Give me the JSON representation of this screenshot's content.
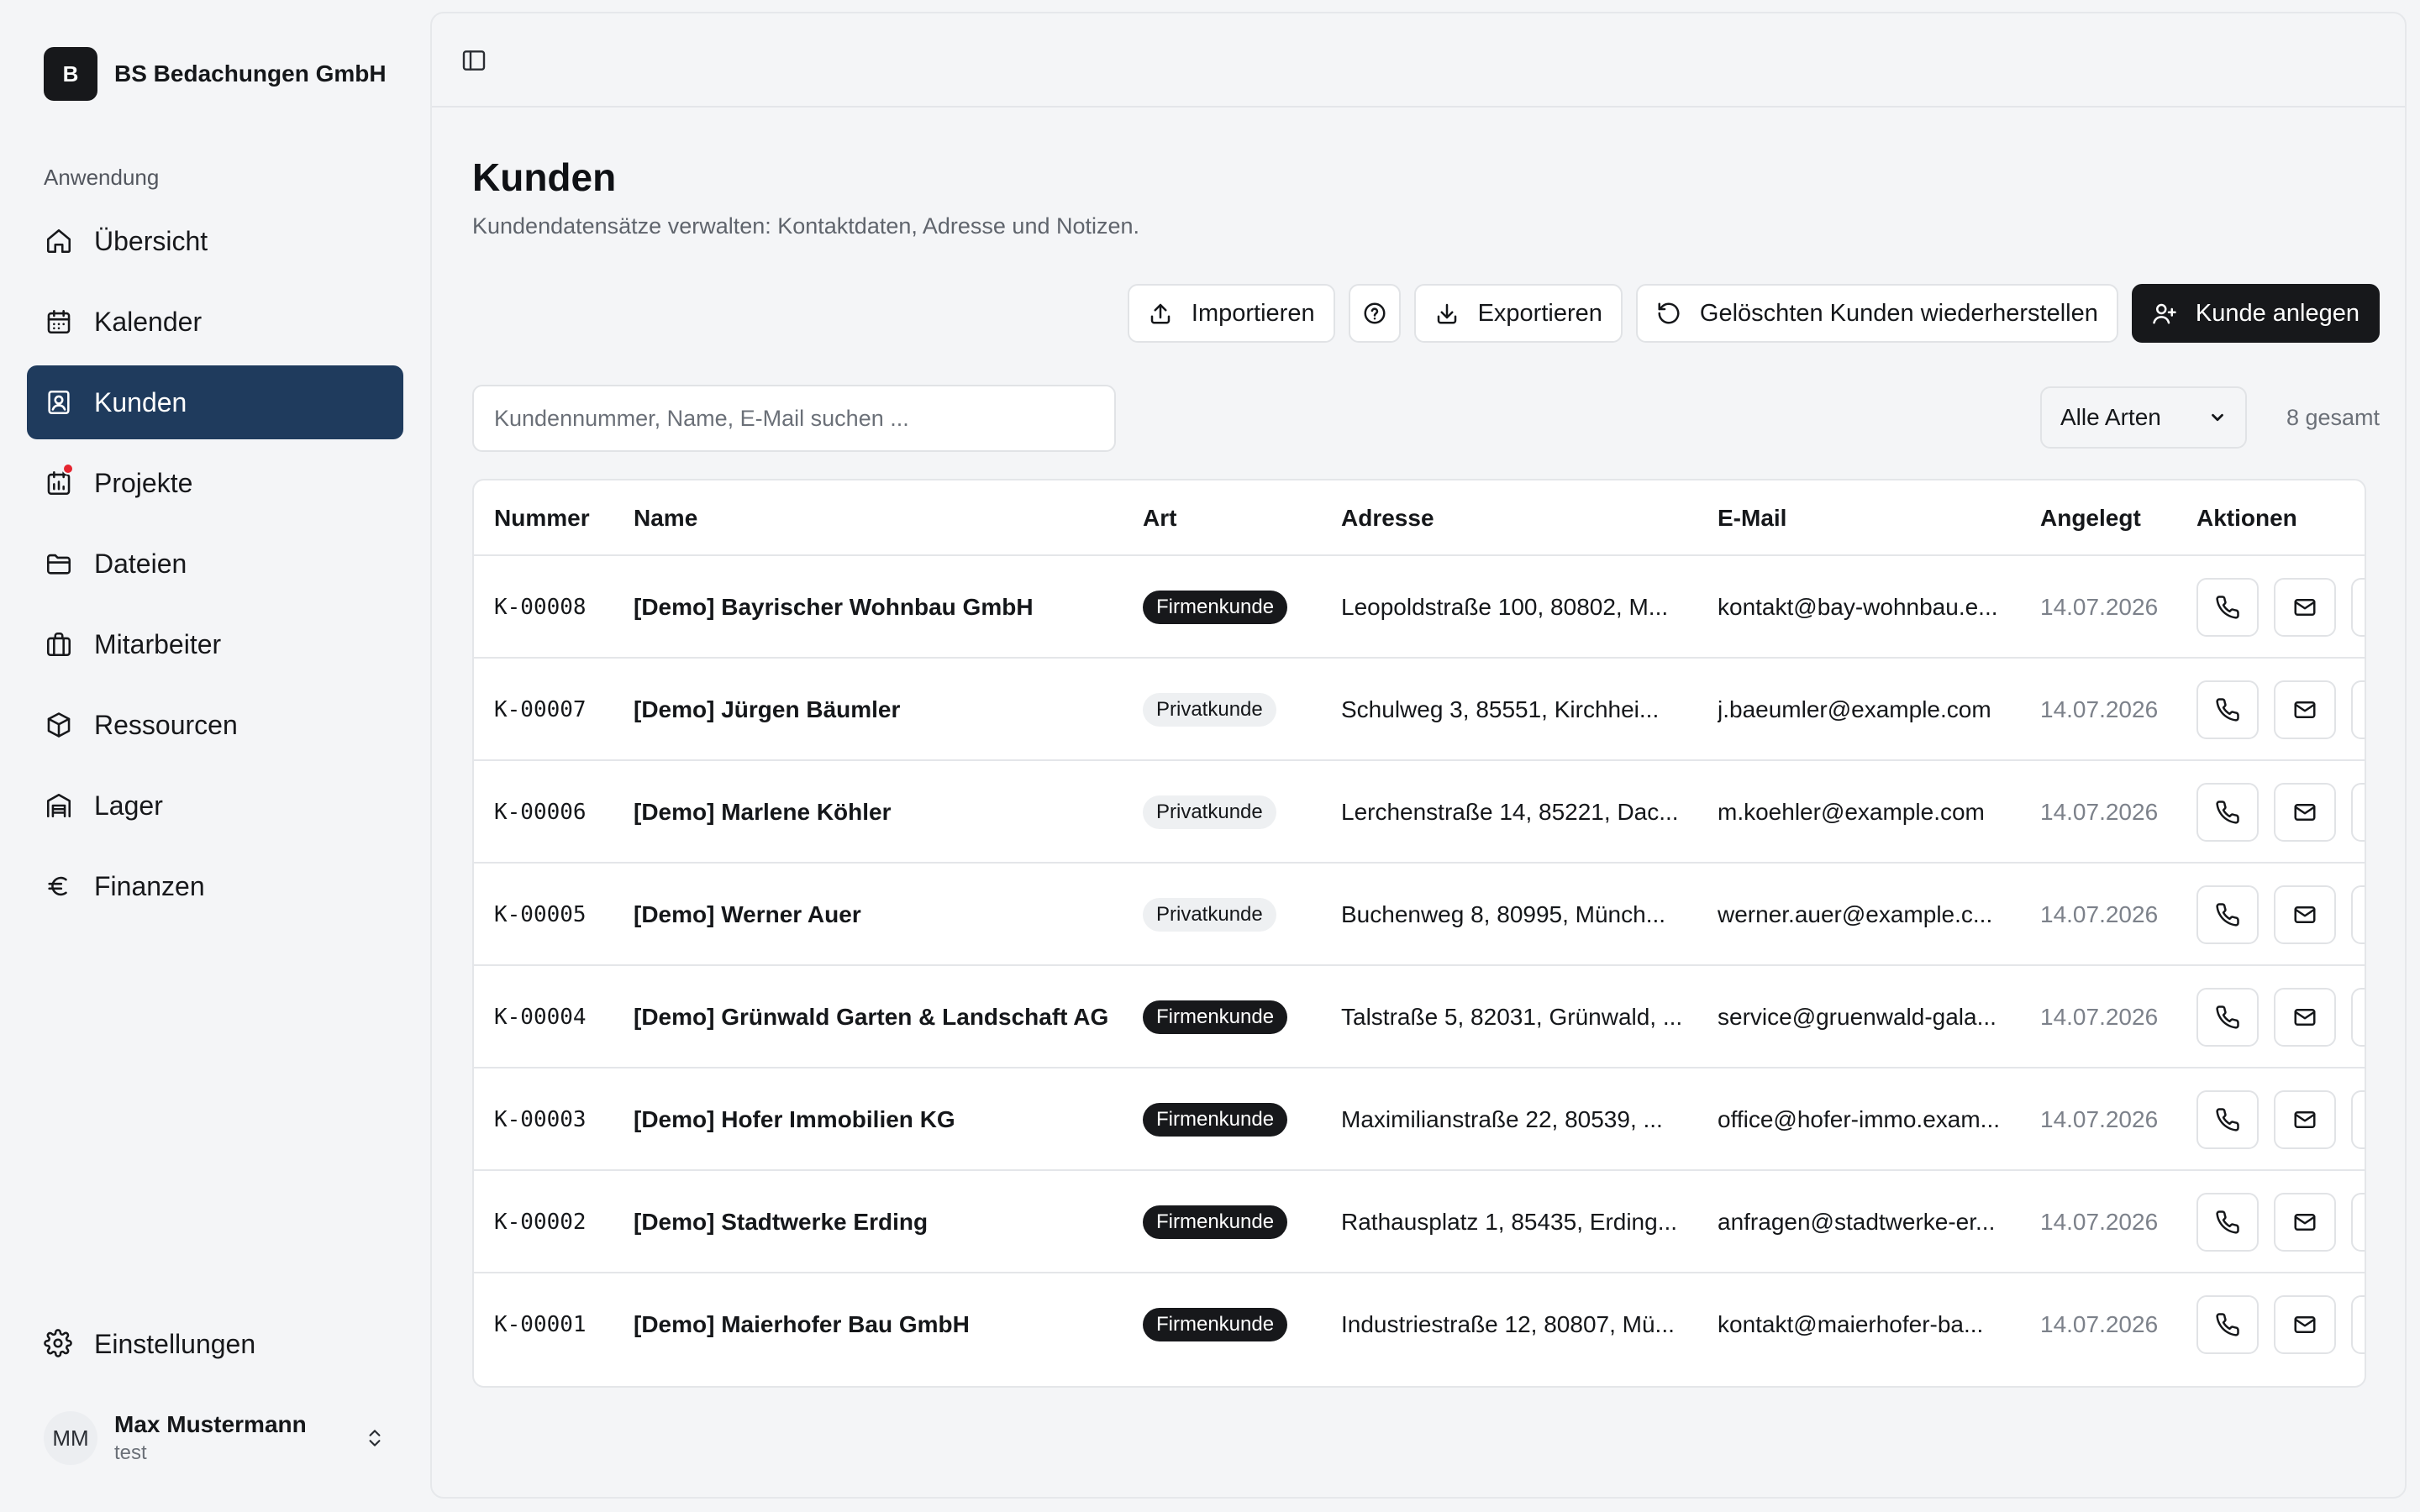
{
  "brand": {
    "initial": "B",
    "name": "BS Bedachungen GmbH"
  },
  "sidebar": {
    "group_label": "Anwendung",
    "items": [
      {
        "label": "Übersicht",
        "icon": "home-icon"
      },
      {
        "label": "Kalender",
        "icon": "calendar-icon"
      },
      {
        "label": "Kunden",
        "icon": "contact-icon",
        "active": true
      },
      {
        "label": "Projekte",
        "icon": "projects-icon",
        "notification": true
      },
      {
        "label": "Dateien",
        "icon": "folder-icon"
      },
      {
        "label": "Mitarbeiter",
        "icon": "briefcase-icon"
      },
      {
        "label": "Ressourcen",
        "icon": "box-icon"
      },
      {
        "label": "Lager",
        "icon": "warehouse-icon"
      },
      {
        "label": "Finanzen",
        "icon": "euro-icon"
      }
    ],
    "settings_label": "Einstellungen"
  },
  "user": {
    "initials": "MM",
    "name": "Max Mustermann",
    "sub": "test"
  },
  "page": {
    "title": "Kunden",
    "subtitle": "Kundendatensätze verwalten: Kontaktdaten, Adresse und Notizen."
  },
  "toolbar": {
    "import_label": "Importieren",
    "export_label": "Exportieren",
    "restore_label": "Gelöschten Kunden wiederherstellen",
    "create_label": "Kunde anlegen"
  },
  "search": {
    "placeholder": "Kundennummer, Name, E-Mail suchen ..."
  },
  "filter": {
    "selected": "Alle Arten"
  },
  "total": "8 gesamt",
  "table": {
    "columns": [
      "Nummer",
      "Name",
      "Art",
      "Adresse",
      "E-Mail",
      "Angelegt",
      "Aktionen"
    ],
    "rows": [
      {
        "number": "K-00008",
        "name": "[Demo] Bayrischer Wohnbau GmbH",
        "type": "Firmenkunde",
        "address": "Leopoldstraße 100, 80802, M...",
        "email": "kontakt@bay-wohnbau.e...",
        "created": "14.07.2026"
      },
      {
        "number": "K-00007",
        "name": "[Demo] Jürgen Bäumler",
        "type": "Privatkunde",
        "address": "Schulweg 3, 85551, Kirchhei...",
        "email": "j.baeumler@example.com",
        "created": "14.07.2026"
      },
      {
        "number": "K-00006",
        "name": "[Demo] Marlene Köhler",
        "type": "Privatkunde",
        "address": "Lerchenstraße 14, 85221, Dac...",
        "email": "m.koehler@example.com",
        "created": "14.07.2026"
      },
      {
        "number": "K-00005",
        "name": "[Demo] Werner Auer",
        "type": "Privatkunde",
        "address": "Buchenweg 8, 80995, Münch...",
        "email": "werner.auer@example.c...",
        "created": "14.07.2026"
      },
      {
        "number": "K-00004",
        "name": "[Demo] Grünwald Garten & Landschaft AG",
        "type": "Firmenkunde",
        "address": "Talstraße 5, 82031, Grünwald, ...",
        "email": "service@gruenwald-gala...",
        "created": "14.07.2026"
      },
      {
        "number": "K-00003",
        "name": "[Demo] Hofer Immobilien KG",
        "type": "Firmenkunde",
        "address": "Maximilianstraße 22, 80539, ...",
        "email": "office@hofer-immo.exam...",
        "created": "14.07.2026"
      },
      {
        "number": "K-00002",
        "name": "[Demo] Stadtwerke Erding",
        "type": "Firmenkunde",
        "address": "Rathausplatz 1, 85435, Erding...",
        "email": "anfragen@stadtwerke-er...",
        "created": "14.07.2026"
      },
      {
        "number": "K-00001",
        "name": "[Demo] Maierhofer Bau GmbH",
        "type": "Firmenkunde",
        "address": "Industriestraße 12, 80807, Mü...",
        "email": "kontakt@maierhofer-ba...",
        "created": "14.07.2026"
      }
    ]
  },
  "colors": {
    "accent": "#1f3b5d",
    "primary_button": "#17181b",
    "notification": "#e5242f"
  }
}
